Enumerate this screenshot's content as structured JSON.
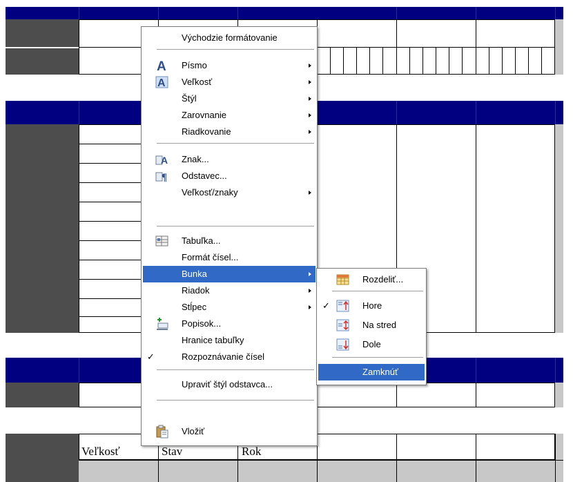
{
  "document": {
    "table_header_labels": [
      "Veľkosť",
      "Stav",
      "Rok"
    ]
  },
  "context_menu": {
    "items": [
      {
        "label": "Východzie formátovanie"
      },
      {
        "label": "Písmo",
        "icon": "font-a-icon",
        "submenu": true
      },
      {
        "label": "Veľkosť",
        "icon": "font-size-a-icon",
        "submenu": true
      },
      {
        "label": "Štýl",
        "submenu": true
      },
      {
        "label": "Zarovnanie",
        "submenu": true
      },
      {
        "label": "Riadkovanie",
        "submenu": true
      },
      {
        "label": "Znak...",
        "icon": "character-icon"
      },
      {
        "label": "Odstavec...",
        "icon": "paragraph-icon"
      },
      {
        "label": "Veľkosť/znaky",
        "submenu": true
      },
      {
        "label": "Tabuľka...",
        "icon": "table-properties-icon"
      },
      {
        "label": "Formát čísel..."
      },
      {
        "label": "Bunka",
        "submenu": true,
        "highlighted": true
      },
      {
        "label": "Riadok",
        "submenu": true
      },
      {
        "label": "Stĺpec",
        "submenu": true
      },
      {
        "label": "Popisok...",
        "icon": "caption-icon"
      },
      {
        "label": "Hranice tabuľky"
      },
      {
        "label": "Rozpoznávanie čísel",
        "checked": true
      },
      {
        "label": "Upraviť štýl odstavca..."
      },
      {
        "label": "Vložiť",
        "icon": "paste-icon"
      }
    ]
  },
  "cell_submenu": {
    "items": [
      {
        "label": "Rozdeliť...",
        "icon": "split-cells-icon"
      },
      {
        "label": "Hore",
        "icon": "align-top-icon",
        "checked": true
      },
      {
        "label": "Na stred",
        "icon": "align-center-icon"
      },
      {
        "label": "Dole",
        "icon": "align-bottom-icon"
      },
      {
        "label": "Zamknúť",
        "highlighted": true
      }
    ]
  },
  "colors": {
    "header_band": "#000080",
    "dark_column": "#4d4d4d",
    "light_column": "#c8c8c8",
    "menu_highlight": "#3169c6"
  }
}
